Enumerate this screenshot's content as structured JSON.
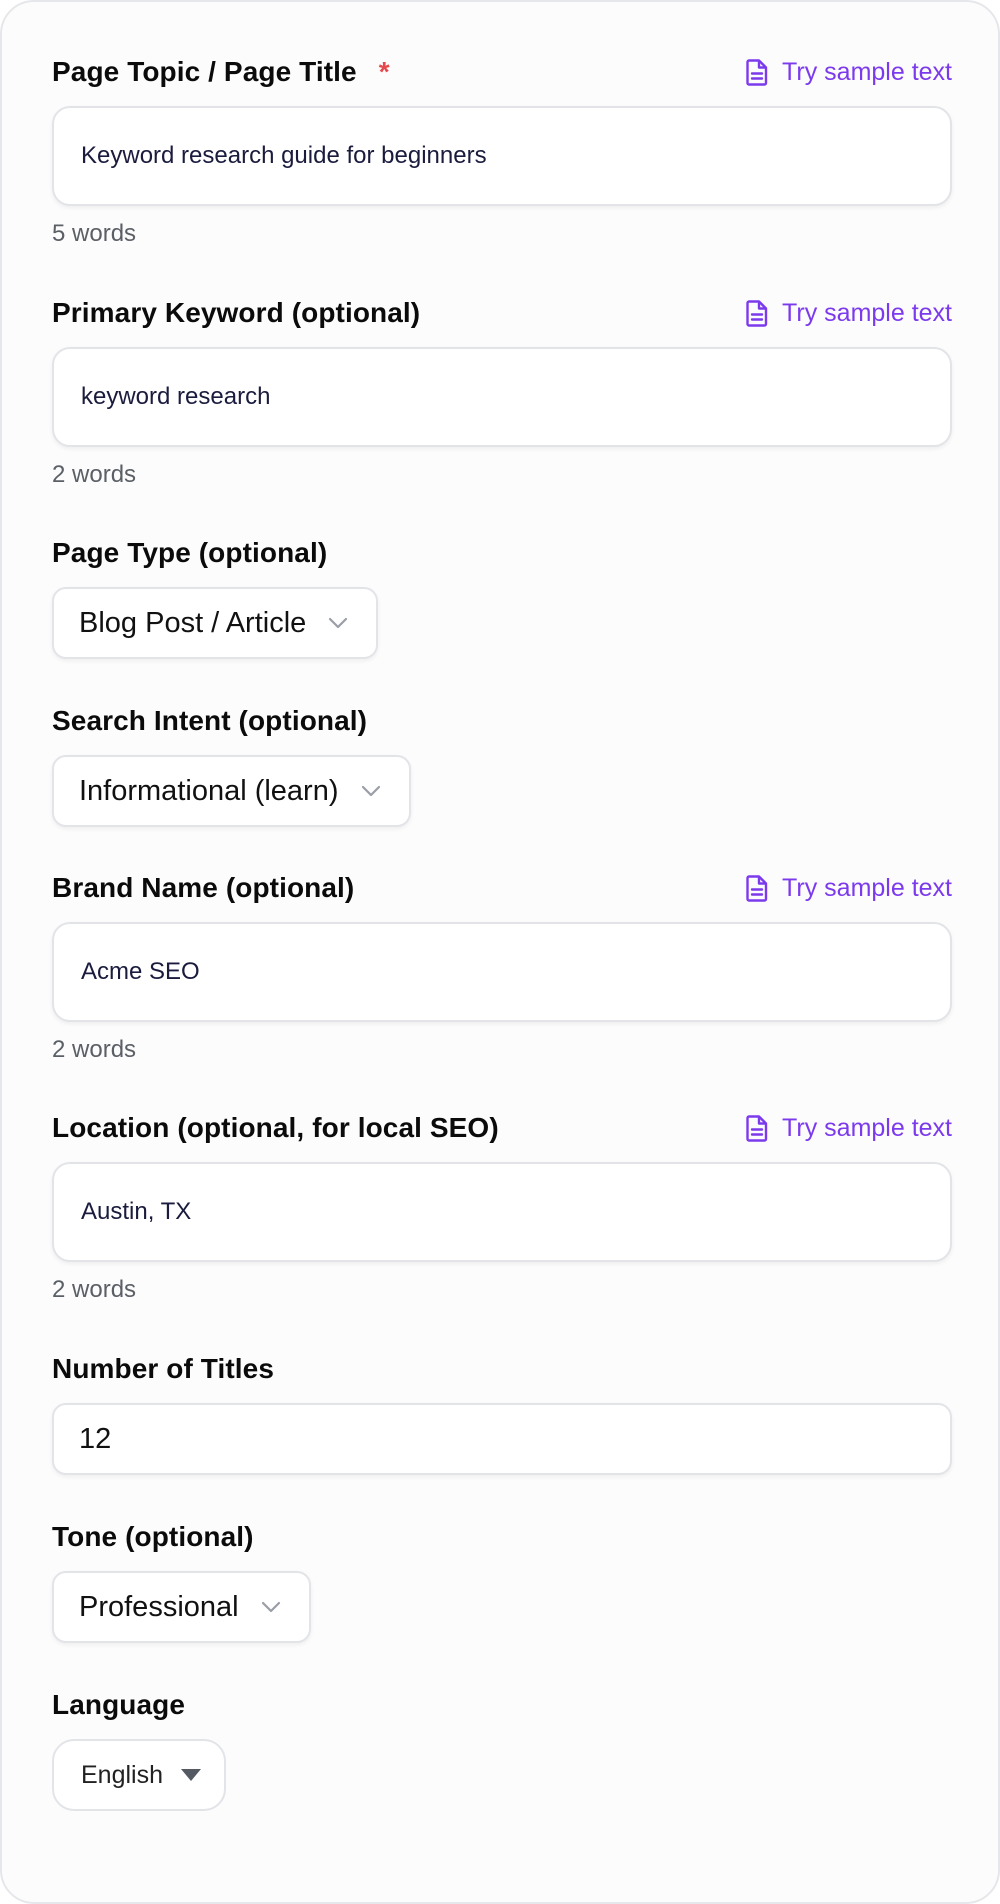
{
  "fields": {
    "page_topic": {
      "label": "Page Topic / Page Title",
      "required_mark": "*",
      "sample_link": "Try sample text",
      "value": "Keyword research guide for beginners",
      "word_count": "5 words"
    },
    "primary_keyword": {
      "label": "Primary Keyword (optional)",
      "sample_link": "Try sample text",
      "value": "keyword research",
      "word_count": "2 words"
    },
    "page_type": {
      "label": "Page Type (optional)",
      "selected": "Blog Post / Article"
    },
    "search_intent": {
      "label": "Search Intent (optional)",
      "selected": "Informational (learn)"
    },
    "brand_name": {
      "label": "Brand Name (optional)",
      "sample_link": "Try sample text",
      "value": "Acme SEO",
      "word_count": "2 words"
    },
    "location": {
      "label": "Location (optional, for local SEO)",
      "sample_link": "Try sample text",
      "value": "Austin, TX",
      "word_count": "2 words"
    },
    "number_of_titles": {
      "label": "Number of Titles",
      "value": "12"
    },
    "tone": {
      "label": "Tone (optional)",
      "selected": "Professional"
    },
    "language": {
      "label": "Language",
      "selected": "English"
    }
  },
  "icons": {
    "sample": "document-icon",
    "chevron": "chevron-down-icon",
    "caret": "caret-down-icon"
  },
  "colors": {
    "accent": "#7c3aed",
    "required": "#e5484d",
    "border": "#e2e4e8",
    "muted_text": "#5b5f66",
    "input_text": "#1a1b3d"
  }
}
